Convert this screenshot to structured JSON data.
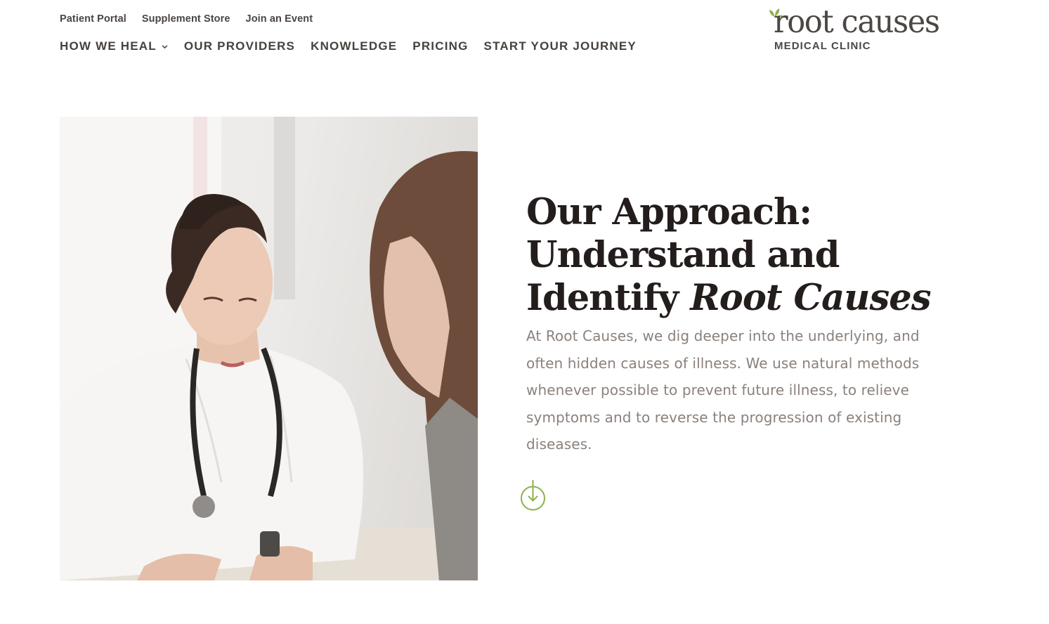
{
  "header": {
    "utility_links": [
      "Patient Portal",
      "Supplement Store",
      "Join an Event"
    ],
    "nav": [
      {
        "label": "HOW WE HEAL",
        "has_dropdown": true
      },
      {
        "label": "OUR PROVIDERS"
      },
      {
        "label": "KNOWLEDGE"
      },
      {
        "label": "PRICING"
      },
      {
        "label": "START YOUR JOURNEY"
      }
    ],
    "logo": {
      "wordmark": "root causes",
      "subline": "MEDICAL CLINIC"
    }
  },
  "hero": {
    "title_line1": "Our Approach:",
    "title_line2": "Understand and",
    "title_line3_plain": "Identify ",
    "title_line3_italic": "Root Causes",
    "body": "At Root Causes, we dig deeper into the underlying, and often hidden causes of illness. We use natural methods whenever possible to prevent future illness, to relieve symptoms and to reverse the progression of existing diseases.",
    "scroll_icon": "arrow-down-circle-icon"
  },
  "colors": {
    "accent_green": "#8db04b",
    "heading": "#231d1c",
    "body_text": "#8a817c",
    "nav_text": "#46413d"
  }
}
